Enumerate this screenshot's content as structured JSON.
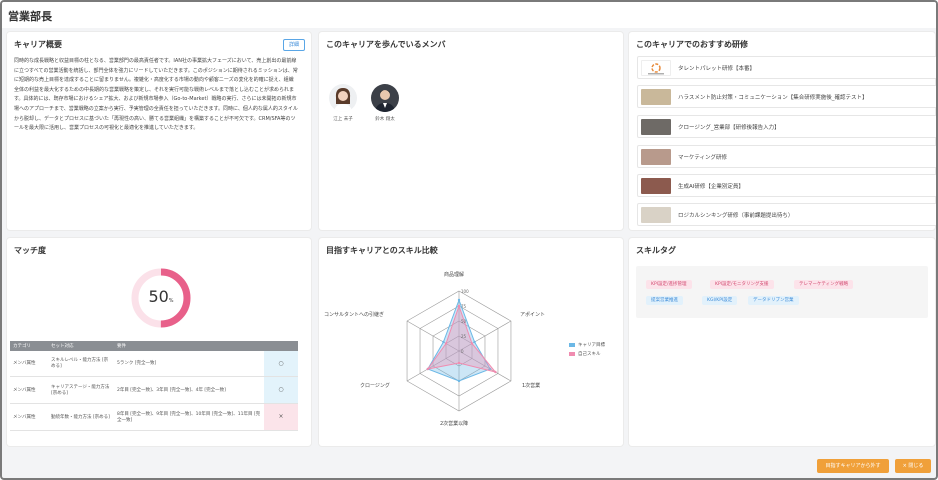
{
  "page": {
    "title": "営業部長"
  },
  "overview": {
    "title": "キャリア概要",
    "detail_label": "詳細",
    "text": "同時的な成長戦略と収益目標の柱となる、営業部門の最高責任者です。IAN社の事業拡大フェーズにおいて、売上創出の最前線に立つすべての営業活動を統括し、部門全体を強力にリードしていただきます。このポジションに期待されるミッションは、常に短期的な売上目標を達成することに留まりません。複雑化・高度化する市場の動向や顧客ニーズの変化を的確に捉え、組織全体の利益を最大化するための中長期的な営業戦略を策定し、それを実行可能な戦術レベルまで落とし込むことが求められます。具体的には、既存市場におけるシェア拡大、および新規市場参入（Go-to-Market）戦略の実行、さらには未開拓の新規市場へのアプローチまで、営業戦略の立案から実行、予実管理の全責任を担っていただきます。同時に、個人的な属人的スタイルから脱却し、データとプロセスに基づいた「再現性の高い、勝てる営業組織」を構築することが不可欠です。CRM/SFA等のツールを最大限に活用し、営業プロセスの可視化と最適化を推進していただきます。"
  },
  "members": {
    "title": "このキャリアを歩んでいるメンバ",
    "items": [
      {
        "name": "江上 未子"
      },
      {
        "name": "鈴木 翔太"
      }
    ]
  },
  "trainings": {
    "title": "このキャリアでのおすすめ研修",
    "items": [
      {
        "label": "タレントパレット研修【本番】",
        "color": "#f7e9d6"
      },
      {
        "label": "ハラスメント防止対策・コミュニケーション【集合研修実施後_確認テスト】",
        "color": "#c9b89a"
      },
      {
        "label": "クロージング_営業部【研修後報告入力】",
        "color": "#6e6a66"
      },
      {
        "label": "マーケティング研修",
        "color": "#b89a8c"
      },
      {
        "label": "生成AI研修【企業別定員】",
        "color": "#8c5a4e"
      },
      {
        "label": "ロジカルシンキング研修（事前課題提出待ち）",
        "color": "#d9d2c6"
      }
    ]
  },
  "match": {
    "title": "マッチ度",
    "value": 50,
    "value_text": "50",
    "unit": "%",
    "columns": [
      "カテゴリ",
      "セット対応",
      "要件",
      ""
    ],
    "rows": [
      {
        "category": "メンバ属性",
        "set": "スキルレベル・能力方法 [宗める]",
        "req": "5ランク [完全一致]",
        "result": "○",
        "ok": true
      },
      {
        "category": "メンバ属性",
        "set": "キャリアステージ・能力方法 [宗める]",
        "req": "2年目 [完全一致]、3年目 [完全一致]、4年 [完全一致]",
        "result": "○",
        "ok": true
      },
      {
        "category": "メンバ属性",
        "set": "勤続年数・能力方法 [宗める]",
        "req": "8年目 [完全一致]、9年目 [完全一致]、10年目 [完全一致]、11年目 [完全一致]",
        "result": "×",
        "ok": false
      }
    ]
  },
  "radar": {
    "title": "目指すキャリアとのスキル比較",
    "axes": [
      "商品理解",
      "アポイント",
      "1次営業",
      "2次営業以降",
      "クロージング",
      "コンサルタントへの引継ぎ"
    ]
  },
  "chart_data": {
    "type": "radar",
    "categories": [
      "商品理解",
      "アポイント",
      "1次営業",
      "2次営業以降",
      "クロージング",
      "コンサルタントへの引継ぎ"
    ],
    "max": 100,
    "ticks": [
      0,
      25,
      50,
      75,
      100
    ],
    "series": [
      {
        "name": "キャリア目標",
        "values": [
          85,
          30,
          60,
          50,
          60,
          30
        ],
        "color": "#6cb8e6"
      },
      {
        "name": "自己スキル",
        "values": [
          75,
          25,
          70,
          20,
          60,
          25
        ],
        "color": "#f08cb0"
      }
    ]
  },
  "skills": {
    "title": "スキルタグ",
    "tags": [
      {
        "label": "KPI設定/進捗管理",
        "kind": "pink"
      },
      {
        "label": "KPI設定/モニタリング支援",
        "kind": "pink"
      },
      {
        "label": "テレマーケティング戦略",
        "kind": "pink"
      },
      {
        "label": "提案営業推進",
        "kind": "blue"
      },
      {
        "label": "KGI/KPI設定",
        "kind": "blue"
      },
      {
        "label": "データドリブン営業",
        "kind": "blue"
      }
    ]
  },
  "footer": {
    "apply_label": "目指すキャリアから外す",
    "close_label": "× 閉じる"
  }
}
